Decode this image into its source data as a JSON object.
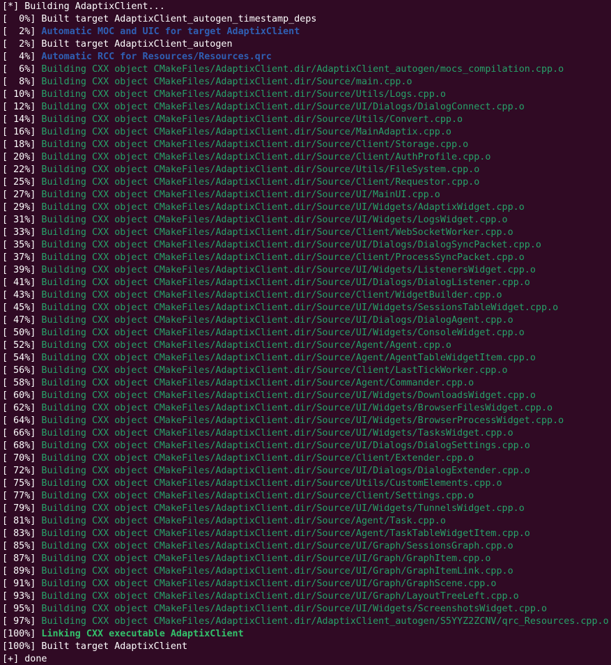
{
  "terminal": {
    "colors": {
      "background": "#300a24",
      "plain": "#ffffff",
      "green": "#26a269",
      "blue": "#2f5fb3",
      "green_bold": "#33c26b"
    },
    "lines": [
      {
        "prefix": "[*]",
        "text": " Building AdaptixClient...",
        "style": "plain"
      },
      {
        "prefix": "[  0%]",
        "text": " Built target AdaptixClient_autogen_timestamp_deps",
        "style": "plain"
      },
      {
        "prefix": "[  2%]",
        "text": " Automatic MOC and UIC for target AdaptixClient",
        "style": "blue"
      },
      {
        "prefix": "[  2%]",
        "text": " Built target AdaptixClient_autogen",
        "style": "plain"
      },
      {
        "prefix": "[  4%]",
        "text": " Automatic RCC for Resources/Resources.qrc",
        "style": "blue"
      },
      {
        "prefix": "[  6%]",
        "text": " Building CXX object CMakeFiles/AdaptixClient.dir/AdaptixClient_autogen/mocs_compilation.cpp.o",
        "style": "green"
      },
      {
        "prefix": "[  8%]",
        "text": " Building CXX object CMakeFiles/AdaptixClient.dir/Source/main.cpp.o",
        "style": "green"
      },
      {
        "prefix": "[ 10%]",
        "text": " Building CXX object CMakeFiles/AdaptixClient.dir/Source/Utils/Logs.cpp.o",
        "style": "green"
      },
      {
        "prefix": "[ 12%]",
        "text": " Building CXX object CMakeFiles/AdaptixClient.dir/Source/UI/Dialogs/DialogConnect.cpp.o",
        "style": "green"
      },
      {
        "prefix": "[ 14%]",
        "text": " Building CXX object CMakeFiles/AdaptixClient.dir/Source/Utils/Convert.cpp.o",
        "style": "green"
      },
      {
        "prefix": "[ 16%]",
        "text": " Building CXX object CMakeFiles/AdaptixClient.dir/Source/MainAdaptix.cpp.o",
        "style": "green"
      },
      {
        "prefix": "[ 18%]",
        "text": " Building CXX object CMakeFiles/AdaptixClient.dir/Source/Client/Storage.cpp.o",
        "style": "green"
      },
      {
        "prefix": "[ 20%]",
        "text": " Building CXX object CMakeFiles/AdaptixClient.dir/Source/Client/AuthProfile.cpp.o",
        "style": "green"
      },
      {
        "prefix": "[ 22%]",
        "text": " Building CXX object CMakeFiles/AdaptixClient.dir/Source/Utils/FileSystem.cpp.o",
        "style": "green"
      },
      {
        "prefix": "[ 25%]",
        "text": " Building CXX object CMakeFiles/AdaptixClient.dir/Source/Client/Requestor.cpp.o",
        "style": "green"
      },
      {
        "prefix": "[ 27%]",
        "text": " Building CXX object CMakeFiles/AdaptixClient.dir/Source/UI/MainUI.cpp.o",
        "style": "green"
      },
      {
        "prefix": "[ 29%]",
        "text": " Building CXX object CMakeFiles/AdaptixClient.dir/Source/UI/Widgets/AdaptixWidget.cpp.o",
        "style": "green"
      },
      {
        "prefix": "[ 31%]",
        "text": " Building CXX object CMakeFiles/AdaptixClient.dir/Source/UI/Widgets/LogsWidget.cpp.o",
        "style": "green"
      },
      {
        "prefix": "[ 33%]",
        "text": " Building CXX object CMakeFiles/AdaptixClient.dir/Source/Client/WebSocketWorker.cpp.o",
        "style": "green"
      },
      {
        "prefix": "[ 35%]",
        "text": " Building CXX object CMakeFiles/AdaptixClient.dir/Source/UI/Dialogs/DialogSyncPacket.cpp.o",
        "style": "green"
      },
      {
        "prefix": "[ 37%]",
        "text": " Building CXX object CMakeFiles/AdaptixClient.dir/Source/Client/ProcessSyncPacket.cpp.o",
        "style": "green"
      },
      {
        "prefix": "[ 39%]",
        "text": " Building CXX object CMakeFiles/AdaptixClient.dir/Source/UI/Widgets/ListenersWidget.cpp.o",
        "style": "green"
      },
      {
        "prefix": "[ 41%]",
        "text": " Building CXX object CMakeFiles/AdaptixClient.dir/Source/UI/Dialogs/DialogListener.cpp.o",
        "style": "green"
      },
      {
        "prefix": "[ 43%]",
        "text": " Building CXX object CMakeFiles/AdaptixClient.dir/Source/Client/WidgetBuilder.cpp.o",
        "style": "green"
      },
      {
        "prefix": "[ 45%]",
        "text": " Building CXX object CMakeFiles/AdaptixClient.dir/Source/UI/Widgets/SessionsTableWidget.cpp.o",
        "style": "green"
      },
      {
        "prefix": "[ 47%]",
        "text": " Building CXX object CMakeFiles/AdaptixClient.dir/Source/UI/Dialogs/DialogAgent.cpp.o",
        "style": "green"
      },
      {
        "prefix": "[ 50%]",
        "text": " Building CXX object CMakeFiles/AdaptixClient.dir/Source/UI/Widgets/ConsoleWidget.cpp.o",
        "style": "green"
      },
      {
        "prefix": "[ 52%]",
        "text": " Building CXX object CMakeFiles/AdaptixClient.dir/Source/Agent/Agent.cpp.o",
        "style": "green"
      },
      {
        "prefix": "[ 54%]",
        "text": " Building CXX object CMakeFiles/AdaptixClient.dir/Source/Agent/AgentTableWidgetItem.cpp.o",
        "style": "green"
      },
      {
        "prefix": "[ 56%]",
        "text": " Building CXX object CMakeFiles/AdaptixClient.dir/Source/Client/LastTickWorker.cpp.o",
        "style": "green"
      },
      {
        "prefix": "[ 58%]",
        "text": " Building CXX object CMakeFiles/AdaptixClient.dir/Source/Agent/Commander.cpp.o",
        "style": "green"
      },
      {
        "prefix": "[ 60%]",
        "text": " Building CXX object CMakeFiles/AdaptixClient.dir/Source/UI/Widgets/DownloadsWidget.cpp.o",
        "style": "green"
      },
      {
        "prefix": "[ 62%]",
        "text": " Building CXX object CMakeFiles/AdaptixClient.dir/Source/UI/Widgets/BrowserFilesWidget.cpp.o",
        "style": "green"
      },
      {
        "prefix": "[ 64%]",
        "text": " Building CXX object CMakeFiles/AdaptixClient.dir/Source/UI/Widgets/BrowserProcessWidget.cpp.o",
        "style": "green"
      },
      {
        "prefix": "[ 66%]",
        "text": " Building CXX object CMakeFiles/AdaptixClient.dir/Source/UI/Widgets/TasksWidget.cpp.o",
        "style": "green"
      },
      {
        "prefix": "[ 68%]",
        "text": " Building CXX object CMakeFiles/AdaptixClient.dir/Source/UI/Dialogs/DialogSettings.cpp.o",
        "style": "green"
      },
      {
        "prefix": "[ 70%]",
        "text": " Building CXX object CMakeFiles/AdaptixClient.dir/Source/Client/Extender.cpp.o",
        "style": "green"
      },
      {
        "prefix": "[ 72%]",
        "text": " Building CXX object CMakeFiles/AdaptixClient.dir/Source/UI/Dialogs/DialogExtender.cpp.o",
        "style": "green"
      },
      {
        "prefix": "[ 75%]",
        "text": " Building CXX object CMakeFiles/AdaptixClient.dir/Source/Utils/CustomElements.cpp.o",
        "style": "green"
      },
      {
        "prefix": "[ 77%]",
        "text": " Building CXX object CMakeFiles/AdaptixClient.dir/Source/Client/Settings.cpp.o",
        "style": "green"
      },
      {
        "prefix": "[ 79%]",
        "text": " Building CXX object CMakeFiles/AdaptixClient.dir/Source/UI/Widgets/TunnelsWidget.cpp.o",
        "style": "green"
      },
      {
        "prefix": "[ 81%]",
        "text": " Building CXX object CMakeFiles/AdaptixClient.dir/Source/Agent/Task.cpp.o",
        "style": "green"
      },
      {
        "prefix": "[ 83%]",
        "text": " Building CXX object CMakeFiles/AdaptixClient.dir/Source/Agent/TaskTableWidgetItem.cpp.o",
        "style": "green"
      },
      {
        "prefix": "[ 85%]",
        "text": " Building CXX object CMakeFiles/AdaptixClient.dir/Source/UI/Graph/SessionsGraph.cpp.o",
        "style": "green"
      },
      {
        "prefix": "[ 87%]",
        "text": " Building CXX object CMakeFiles/AdaptixClient.dir/Source/UI/Graph/GraphItem.cpp.o",
        "style": "green"
      },
      {
        "prefix": "[ 89%]",
        "text": " Building CXX object CMakeFiles/AdaptixClient.dir/Source/UI/Graph/GraphItemLink.cpp.o",
        "style": "green"
      },
      {
        "prefix": "[ 91%]",
        "text": " Building CXX object CMakeFiles/AdaptixClient.dir/Source/UI/Graph/GraphScene.cpp.o",
        "style": "green"
      },
      {
        "prefix": "[ 93%]",
        "text": " Building CXX object CMakeFiles/AdaptixClient.dir/Source/UI/Graph/LayoutTreeLeft.cpp.o",
        "style": "green"
      },
      {
        "prefix": "[ 95%]",
        "text": " Building CXX object CMakeFiles/AdaptixClient.dir/Source/UI/Widgets/ScreenshotsWidget.cpp.o",
        "style": "green"
      },
      {
        "prefix": "[ 97%]",
        "text": " Building CXX object CMakeFiles/AdaptixClient.dir/AdaptixClient_autogen/S5YYZ2ZCNV/qrc_Resources.cpp.o",
        "style": "green"
      },
      {
        "prefix": "[100%]",
        "text": " Linking CXX executable AdaptixClient",
        "style": "green_bold"
      },
      {
        "prefix": "[100%]",
        "text": " Built target AdaptixClient",
        "style": "plain"
      },
      {
        "prefix": "[+]",
        "text": " done",
        "style": "plain"
      }
    ]
  }
}
